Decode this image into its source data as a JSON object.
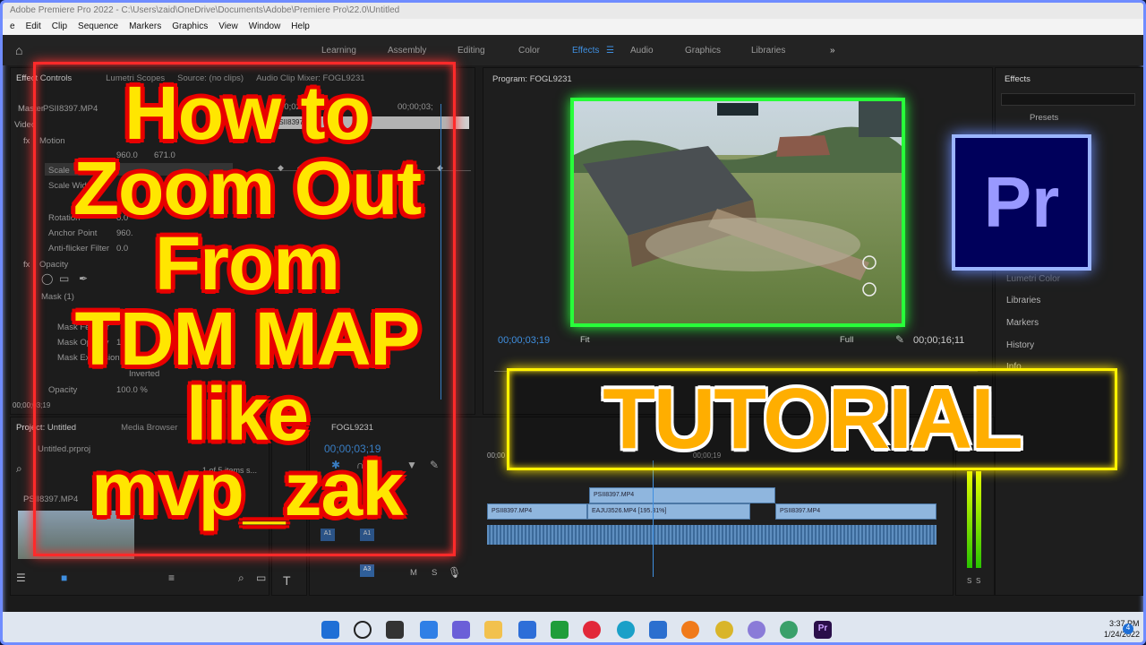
{
  "titlebar": {
    "text": "Adobe Premiere Pro 2022 - C:\\Users\\zaid\\OneDrive\\Documents\\Adobe\\Premiere Pro\\22.0\\Untitled"
  },
  "menu": [
    "e",
    "Edit",
    "Clip",
    "Sequence",
    "Markers",
    "Graphics",
    "View",
    "Window",
    "Help"
  ],
  "workspaces": [
    "Learning",
    "Assembly",
    "Editing",
    "Color",
    "Effects",
    "Audio",
    "Graphics",
    "Libraries"
  ],
  "active_workspace": "Effects",
  "effect_controls": {
    "tabs": [
      "Effect Controls",
      "Lumetri Scopes",
      "Source: (no clips)",
      "Audio Clip Mixer: FOGL9231"
    ],
    "master_label": "Master",
    "clip_name": "PSII8397.MP4",
    "timecode_left": "00;02;14",
    "timecode_right": "00;00;03;",
    "clip_bar": "PSII8397.MP4",
    "video_label": "Video",
    "motion": "Motion",
    "position_values": [
      "960.0",
      "671.0"
    ],
    "scale_label": "Scale",
    "scale_width": "Scale Width",
    "rotation": "Rotation",
    "rotation_value": "0.0",
    "anchor_point": "Anchor Point",
    "anchor_value": "960.",
    "anti_flicker": "Anti-flicker Filter",
    "anti_flicker_value": "0.0",
    "opacity_section": "Opacity",
    "mask": "Mask (1)",
    "mask_feather": "Mask Feather",
    "mask_opacity": "Mask Opacity",
    "mask_expansion": "Mask Expansion",
    "mask_opacity_value": "100.0",
    "inverted": "Inverted",
    "opacity_label": "Opacity",
    "opacity_value": "100.0 %",
    "bottom_tc": "00;00;03;19"
  },
  "project": {
    "tabs": [
      "Project: Untitled",
      "Media Browser"
    ],
    "file": "Untitled.prproj",
    "items_count": "1 of 5 items s...",
    "thumb_name": "PSII8397.MP4",
    "thumb_dur": "28"
  },
  "timeline": {
    "sequence": "FOGL9231",
    "timecode": "00;00;03;19",
    "ruler_start": "00;00",
    "ruler_mark": "00;00;19",
    "tracks": [
      "A1",
      "A1",
      "A3"
    ],
    "clips_v2": [
      "PSII8397.MP4"
    ],
    "clips_v1": [
      "PSII8397.MP4",
      "EAJU3526.MP4 [195.31%]",
      "PSII8397.MP4"
    ],
    "meter_labels": [
      "S",
      "S"
    ]
  },
  "program": {
    "label": "Program: FOGL9231",
    "timecode_left": "00;00;03;19",
    "fit": "Fit",
    "full": "Full",
    "timecode_right": "00;00;16;11"
  },
  "effects_panel": {
    "title": "Effects",
    "presets": "Presets",
    "items": [
      "Lumetri Color",
      "Libraries",
      "Markers",
      "History",
      "Info"
    ]
  },
  "overlay": {
    "title_lines": [
      "How to",
      "Zoom Out",
      "From",
      "TDM MAP",
      "like",
      "mvp_zak"
    ],
    "tutorial": "TUTORIAL",
    "logo": "Pr"
  },
  "taskbar": {
    "time": "3:37 PM",
    "date": "1/24/2022",
    "badge": "4"
  },
  "colors": {
    "title_fill": "#ffe600",
    "title_outline": "#e80000",
    "red_frame": "#ff2a2a",
    "green_frame": "#28ff3a",
    "yellow_frame": "#fff200",
    "logo_bg": "#00005b",
    "accent_blue": "#3f8fe0"
  }
}
